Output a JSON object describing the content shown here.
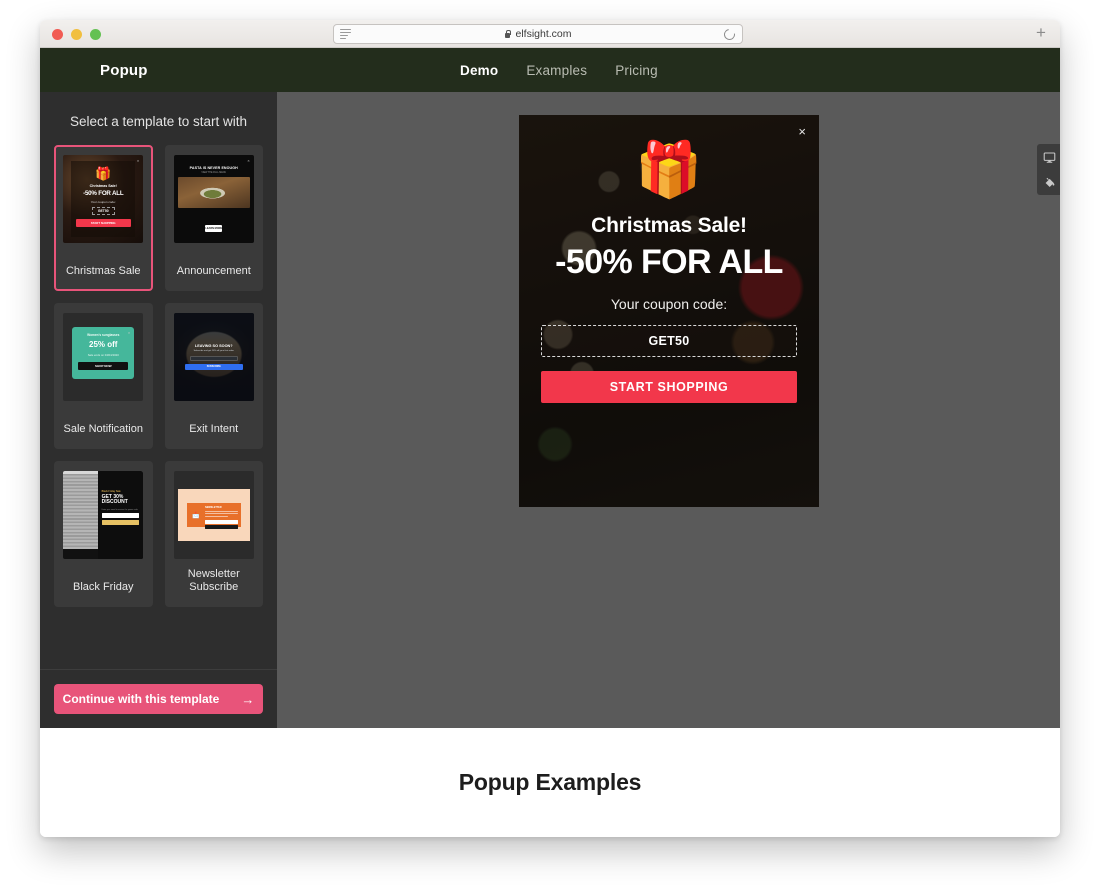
{
  "browser": {
    "url": "elfsight.com",
    "lock_icon": "lock-icon",
    "reader_icon": "reader-view-icon",
    "reload_icon": "reload-icon",
    "newtab_label": "+"
  },
  "site_nav": {
    "brand": "Popup",
    "links": [
      {
        "label": "Demo",
        "active": true
      },
      {
        "label": "Examples",
        "active": false
      },
      {
        "label": "Pricing",
        "active": false
      }
    ]
  },
  "sidebar": {
    "title": "Select a template to start with",
    "continue_label": "Continue with this template",
    "continue_arrow": "→",
    "templates": [
      {
        "label": "Christmas Sale",
        "selected": true,
        "thumb": {
          "gift": "🎁",
          "title": "Christmas Sale!",
          "headline": "-50% FOR ALL",
          "sub": "Your coupon code:",
          "code": "GET50",
          "cta": "START SHOPPING",
          "close": "×"
        }
      },
      {
        "label": "Announcement",
        "selected": false,
        "thumb": {
          "title": "PASTA IS NEVER ENOUGH",
          "sub": "VIEW THE FULL MENU",
          "cta": "LEARN MORE"
        }
      },
      {
        "label": "Sale Notification",
        "selected": false,
        "thumb": {
          "title": "Women's sunglasses",
          "headline": "25% off",
          "sub": "Sale ends on 04/04/2020",
          "cta": "SHOP NOW"
        }
      },
      {
        "label": "Exit Intent",
        "selected": false,
        "thumb": {
          "title": "LEAVING SO SOON?",
          "sub": "Subscribe and get 10% off your first order",
          "cta": "SUBSCRIBE"
        }
      },
      {
        "label": "Black Friday",
        "selected": false,
        "thumb": {
          "eyebrow": "Black Friday Sale",
          "headline": "GET 30% DISCOUNT",
          "sub": "Enter your email to receive the promo code"
        }
      },
      {
        "label": "Newsletter Subscribe",
        "selected": false,
        "thumb": {
          "icon": "📩",
          "title": "NEWSLETTER"
        }
      }
    ]
  },
  "canvas": {
    "toolbar": [
      {
        "name": "device-preview-icon",
        "label": "Desktop preview"
      },
      {
        "name": "fill-color-icon",
        "label": "Background color"
      }
    ],
    "popup": {
      "close_label": "×",
      "gift_icon": "🎁",
      "title": "Christmas Sale!",
      "headline": "-50% FOR ALL",
      "coupon_label": "Your coupon code:",
      "coupon_code": "GET50",
      "cta_label": "START SHOPPING"
    }
  },
  "page_bottom": {
    "heading": "Popup Examples"
  },
  "colors": {
    "nav_bg": "#232d1c",
    "sidebar_bg": "#2e2e2e",
    "canvas_bg": "#5a5a5a",
    "accent_pink": "#e8547a",
    "accent_red": "#f2374b",
    "sale_teal": "#45b79b",
    "newsletter_orange": "#e8702a"
  }
}
